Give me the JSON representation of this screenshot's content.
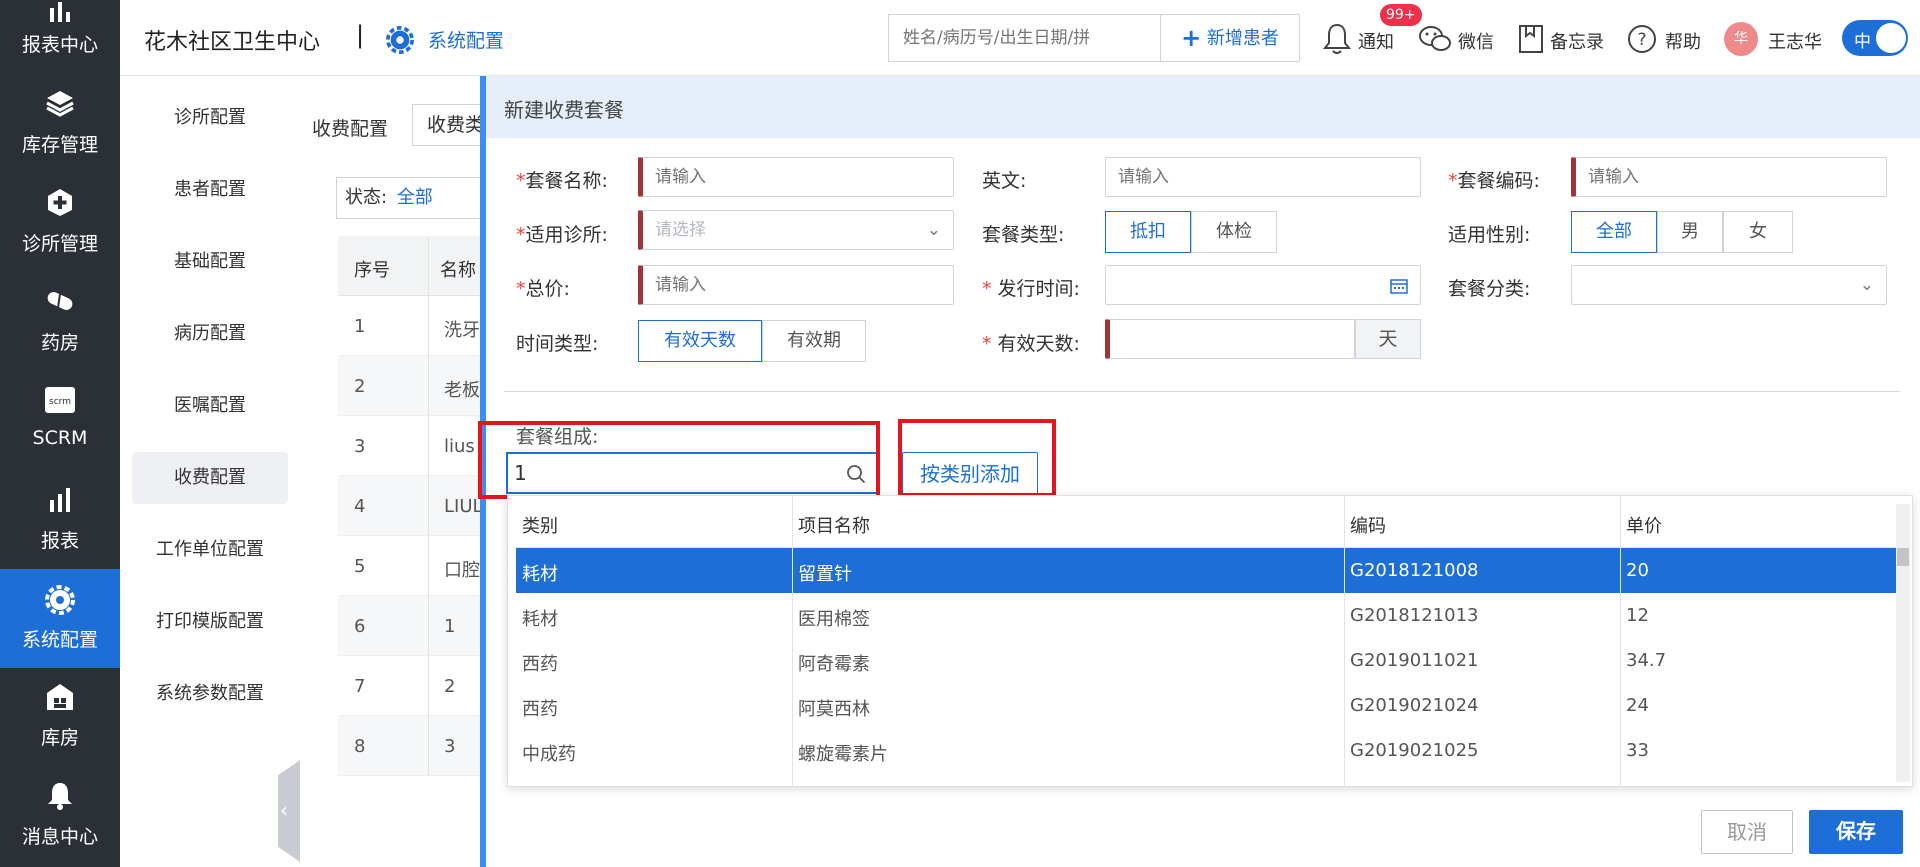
{
  "app": {
    "clinic_name": "花木社区卫生中心",
    "separator": "|",
    "module_title": "系统配置",
    "search_placeholder": "姓名/病历号/出生日期/拼",
    "add_patient_label": "新增患者",
    "notify_label": "通知",
    "notify_badge": "99+",
    "wechat_label": "微信",
    "memo_label": "备忘录",
    "help_label": "帮助",
    "user_name": "王志华",
    "avatar_text": "华",
    "lang_toggle": "中"
  },
  "leftnav": [
    {
      "label": "报表中心",
      "icon": "bar-chart-icon"
    },
    {
      "label": "库存管理",
      "icon": "layers-icon"
    },
    {
      "label": "诊所管理",
      "icon": "medical-cross-icon"
    },
    {
      "label": "药房",
      "icon": "pill-icon"
    },
    {
      "label": "SCRM",
      "icon": "scrm-icon"
    },
    {
      "label": "报表",
      "icon": "bar-chart-icon"
    },
    {
      "label": "系统配置",
      "icon": "gear-icon",
      "active": true
    },
    {
      "label": "库房",
      "icon": "warehouse-icon"
    },
    {
      "label": "消息中心",
      "icon": "bell-icon"
    }
  ],
  "config_menu": [
    "诊所配置",
    "患者配置",
    "基础配置",
    "病历配置",
    "医嘱配置",
    "收费配置",
    "工作单位配置",
    "打印模版配置",
    "系统参数配置"
  ],
  "background": {
    "title": "收费配置",
    "tab": "收费类",
    "status_label": "状态:",
    "status_value": "全部",
    "col_index": "序号",
    "col_name": "名称",
    "rows": [
      {
        "idx": "1",
        "name": "洗牙"
      },
      {
        "idx": "2",
        "name": "老板"
      },
      {
        "idx": "3",
        "name": "lius"
      },
      {
        "idx": "4",
        "name": "LIUL"
      },
      {
        "idx": "5",
        "name": "口腔"
      },
      {
        "idx": "6",
        "name": "1"
      },
      {
        "idx": "7",
        "name": "2"
      },
      {
        "idx": "8",
        "name": "3"
      }
    ]
  },
  "modal": {
    "title": "新建收费套餐",
    "package_name_label": "套餐名称:",
    "package_name_placeholder": "请输入",
    "english_label": "英文:",
    "english_placeholder": "请输入",
    "package_code_label": "套餐编码:",
    "package_code_placeholder": "请输入",
    "clinic_label": "适用诊所:",
    "clinic_placeholder": "请选择",
    "package_type_label": "套餐类型:",
    "package_type_options": [
      "抵扣",
      "体检"
    ],
    "gender_label": "适用性别:",
    "gender_options": [
      "全部",
      "男",
      "女"
    ],
    "total_label": "总价:",
    "total_placeholder": "请输入",
    "issue_time_label": "发行时间:",
    "category_label": "套餐分类:",
    "time_type_label": "时间类型:",
    "time_type_options": [
      "有效天数",
      "有效期"
    ],
    "valid_days_label": "有效天数:",
    "valid_days_unit": "天",
    "composition_label": "套餐组成:",
    "composition_search_value": "1",
    "add_by_category_label": "按类别添加",
    "cancel_label": "取消",
    "save_label": "保存"
  },
  "dropdown": {
    "headers": [
      "类别",
      "项目名称",
      "编码",
      "单价"
    ],
    "rows": [
      {
        "category": "耗材",
        "name": "留置针",
        "code": "G2018121008",
        "price": "20"
      },
      {
        "category": "耗材",
        "name": "医用棉签",
        "code": "G2018121013",
        "price": "12"
      },
      {
        "category": "西药",
        "name": "阿奇霉素",
        "code": "G2019011021",
        "price": "34.7"
      },
      {
        "category": "西药",
        "name": "阿莫西林",
        "code": "G2019021024",
        "price": "24"
      },
      {
        "category": "中成药",
        "name": "螺旋霉素片",
        "code": "G2019021025",
        "price": "33"
      }
    ]
  },
  "colors": {
    "primary": "#1d6ed6",
    "nav_bg": "#2b2f36",
    "highlight_box": "#e8141b"
  }
}
